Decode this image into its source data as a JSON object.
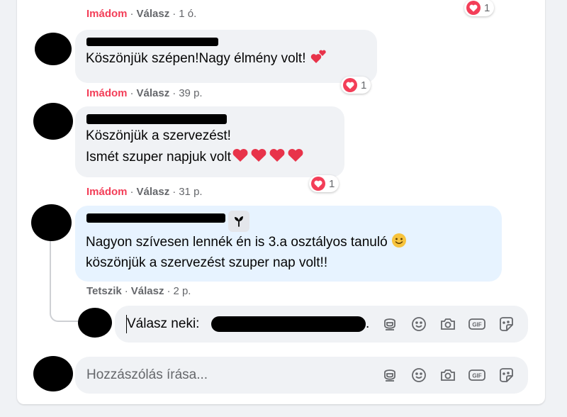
{
  "colors": {
    "loved": "#f33e58",
    "meta": "#65676b",
    "bubble": "#f0f2f5",
    "highlight": "#e7f3ff"
  },
  "top": {
    "love_label": "Imádom",
    "reply_label": "Válasz",
    "time": "1 ó.",
    "reaction_count": "1"
  },
  "comments": [
    {
      "lines": [
        "Köszönjük szépen!Nagy élmény volt! "
      ],
      "trailing_emoji": "two-hearts-icon",
      "love_label": "Imádom",
      "reply_label": "Válasz",
      "time": "39 p.",
      "reaction_count": "1"
    },
    {
      "lines": [
        "Köszönjük a szervezést!",
        "Ismét szuper napjuk volt"
      ],
      "trailing_emoji": "red-heart-icon",
      "love_label": "Imádom",
      "reply_label": "Válasz",
      "time": "31 p.",
      "reaction_count": "1"
    },
    {
      "lines": [
        "Nagyon szívesen lennék én is 3.a osztályos tanuló ",
        "köszönjük a szervezést szuper nap volt!!"
      ],
      "trailing_emoji": "smiling-face-icon",
      "like_label": "Tetszik",
      "reply_label": "Válasz",
      "time": "2 p."
    }
  ],
  "reply_input": {
    "prefix": "Válasz neki:",
    "suffix": "."
  },
  "comment_input": {
    "placeholder": "Hozzászólás írása..."
  },
  "toolbar_icons": [
    "avatar-sticker-icon",
    "emoji-icon",
    "camera-icon",
    "gif-icon",
    "sticker-icon"
  ]
}
